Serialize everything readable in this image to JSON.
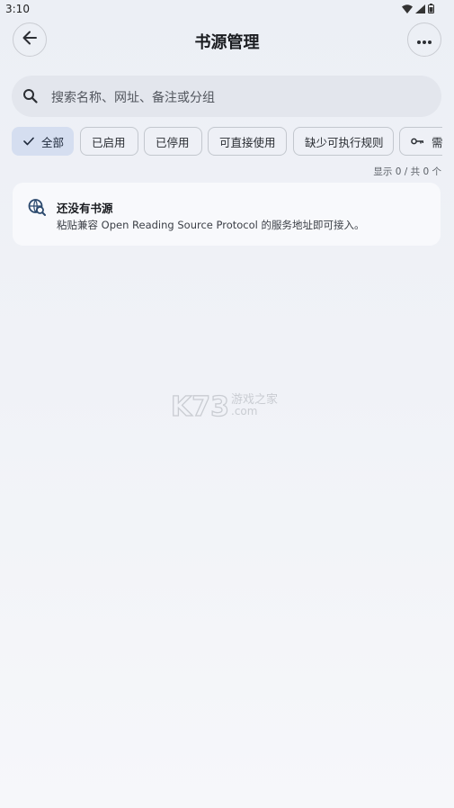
{
  "status_bar": {
    "time": "3:10",
    "icons": [
      "wifi-icon",
      "signal-icon",
      "battery-icon"
    ]
  },
  "header": {
    "title": "书源管理",
    "back_icon": "arrow-left-icon",
    "more_icon": "more-horizontal-icon"
  },
  "search": {
    "placeholder": "搜索名称、网址、备注或分组",
    "icon": "search-icon"
  },
  "filters": [
    {
      "label": "全部",
      "selected": true,
      "icon": "check-icon"
    },
    {
      "label": "已启用",
      "selected": false
    },
    {
      "label": "已停用",
      "selected": false
    },
    {
      "label": "可直接使用",
      "selected": false
    },
    {
      "label": "缺少可执行规则",
      "selected": false
    },
    {
      "label": "需登",
      "selected": false,
      "icon": "key-icon"
    }
  ],
  "count_text": "显示 0 / 共 0 个",
  "empty_state": {
    "icon": "source-search-icon",
    "title": "还没有书源",
    "description": "粘贴兼容 Open Reading Source Protocol 的服务地址即可接入。"
  },
  "watermark": {
    "main": "K73",
    "sub_top": "游戏之家",
    "sub_bottom": ".com"
  },
  "colors": {
    "background": "#eef0f5",
    "chip_selected": "#d5def0",
    "search_bg": "#e3e6ed",
    "card_bg": "#f8f9fc",
    "accent": "#2c4a6e"
  }
}
